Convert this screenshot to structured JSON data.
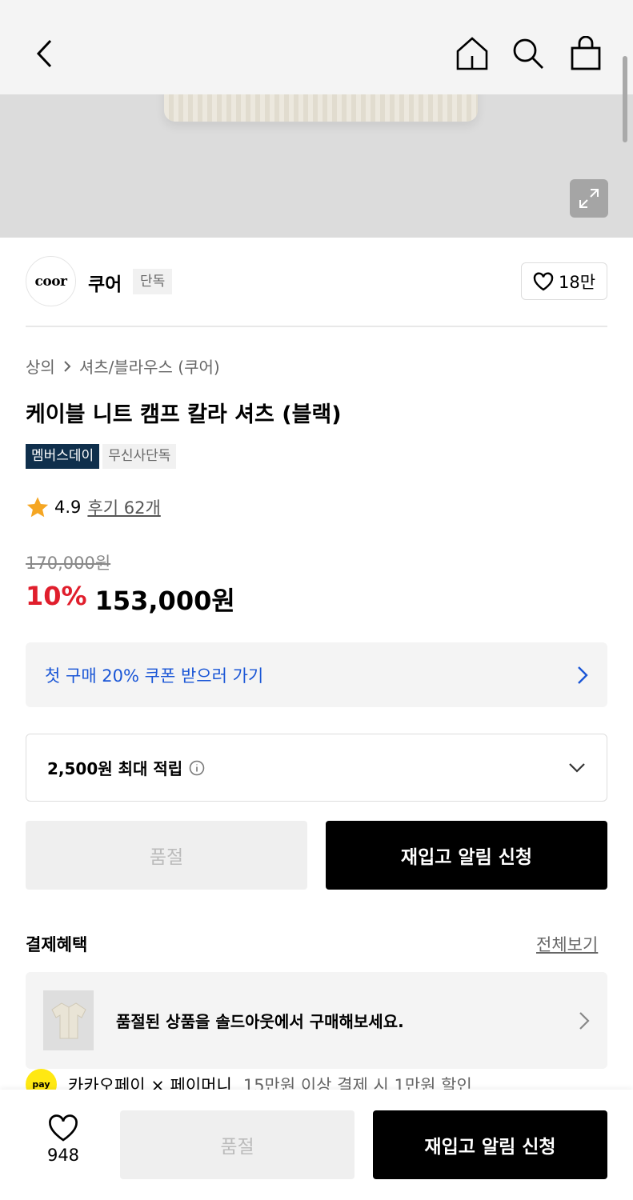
{
  "icons": {
    "back": "chevron-left-icon",
    "home": "home-icon",
    "search": "search-icon",
    "cart": "shopping-bag-icon",
    "expand": "expand-icon",
    "heart": "heart-icon",
    "star": "star-icon",
    "info": "info-icon"
  },
  "brand": {
    "logo_text": "coor",
    "name": "쿠어",
    "tag": "단독",
    "likes": "18만"
  },
  "breadcrumb": {
    "category": "상의",
    "subcategory": "셔츠/블라우스 (쿠어)"
  },
  "product": {
    "title": "케이블 니트 캠프 칼라 셔츠 (블랙)",
    "badges": [
      "멤버스데이",
      "무신사단독"
    ],
    "rating": "4.9",
    "reviews": "후기 62개",
    "original_price": "170,000원",
    "discount": "10%",
    "price": "153,000원"
  },
  "coupon": {
    "label": "첫 구매 20% 쿠폰 받으러 가기"
  },
  "points": {
    "label": "2,500원 최대 적립"
  },
  "actions": {
    "sold_out": "품절",
    "restock": "재입고 알림 신청"
  },
  "benefits": {
    "title": "결제혜택",
    "view_all": "전체보기",
    "soldout_banner": "품절된 상품을 솔드아웃에서 구매해보세요.",
    "pay_logo": "pay",
    "pay_name": "카카오페이 × 페이머니",
    "pay_desc": "15만원 이상 결제 시 1만원 할인"
  },
  "bottom_bar": {
    "wish_count": "948",
    "sold_out": "품절",
    "restock": "재입고 알림 신청"
  },
  "colors": {
    "discount_red": "#e01e2c",
    "link_blue": "#1a56d6",
    "badge_navy": "#0f2f4c",
    "star": "#f5a623"
  }
}
